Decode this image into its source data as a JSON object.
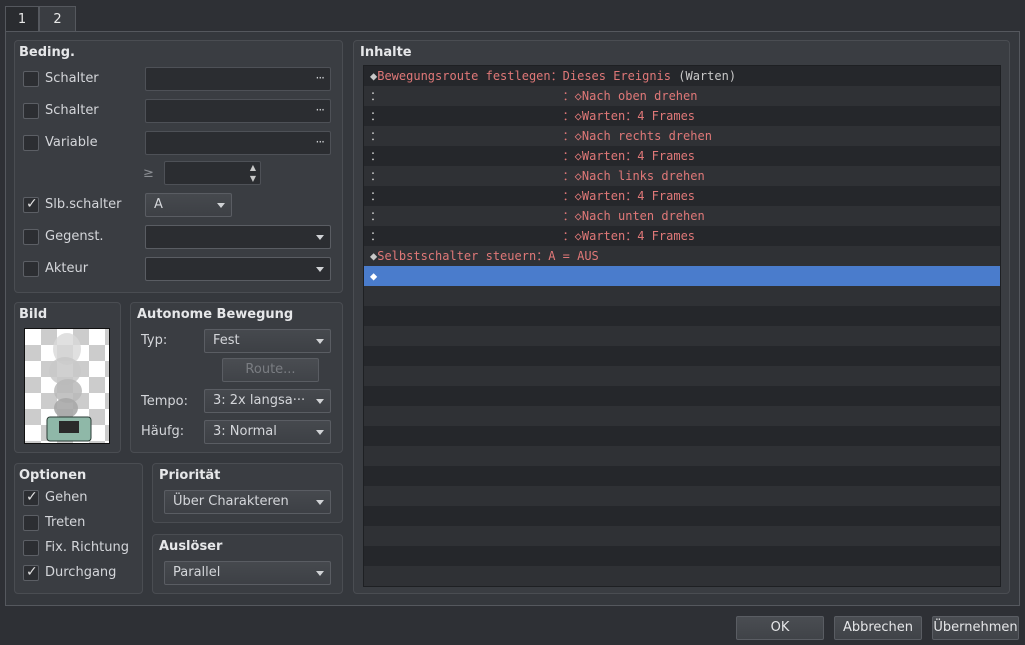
{
  "tabs": [
    {
      "label": "1"
    },
    {
      "label": "2"
    }
  ],
  "conditions": {
    "title": "Beding.",
    "switch1": {
      "label": "Schalter",
      "value": "",
      "button": "···"
    },
    "switch2": {
      "label": "Schalter",
      "value": "",
      "button": "···"
    },
    "variable": {
      "label": "Variable",
      "value": "",
      "button": "···"
    },
    "compare": {
      "symbol": "≥",
      "value": ""
    },
    "self_switch": {
      "label": "Slb.schalter",
      "checked": true,
      "value": "A"
    },
    "item": {
      "label": "Gegenst.",
      "value": ""
    },
    "actor": {
      "label": "Akteur",
      "value": ""
    }
  },
  "image": {
    "title": "Bild"
  },
  "autonomous": {
    "title": "Autonome Bewegung",
    "type_label": "Typ:",
    "type_value": "Fest",
    "route_button": "Route...",
    "speed_label": "Tempo:",
    "speed_value": "3: 2x langsa···",
    "freq_label": "Häufg:",
    "freq_value": "3: Normal"
  },
  "options": {
    "title": "Optionen",
    "items": [
      {
        "label": "Gehen",
        "checked": true
      },
      {
        "label": "Treten",
        "checked": false
      },
      {
        "label": "Fix. Richtung",
        "checked": false
      },
      {
        "label": "Durchgang",
        "checked": true
      }
    ]
  },
  "priority": {
    "title": "Priorität",
    "value": "Über Charakteren"
  },
  "trigger": {
    "title": "Auslöser",
    "value": "Parallel"
  },
  "contents": {
    "title": "Inhalte",
    "rows": [
      {
        "marker": "◆",
        "text": "Bewegungsroute festlegen",
        "sep": "：",
        "rest": "Dieses Ereignis",
        "suffix": " (Warten)"
      },
      {
        "marker": "：",
        "pad": "                         ",
        "sep": "：",
        "rest": "◇Nach oben drehen"
      },
      {
        "marker": "：",
        "pad": "                         ",
        "sep": "：",
        "rest": "◇Warten：4 Frames"
      },
      {
        "marker": "：",
        "pad": "                         ",
        "sep": "：",
        "rest": "◇Nach rechts drehen"
      },
      {
        "marker": "：",
        "pad": "                         ",
        "sep": "：",
        "rest": "◇Warten：4 Frames"
      },
      {
        "marker": "：",
        "pad": "                         ",
        "sep": "：",
        "rest": "◇Nach links drehen"
      },
      {
        "marker": "：",
        "pad": "                         ",
        "sep": "：",
        "rest": "◇Warten：4 Frames"
      },
      {
        "marker": "：",
        "pad": "                         ",
        "sep": "：",
        "rest": "◇Nach unten drehen"
      },
      {
        "marker": "：",
        "pad": "                         ",
        "sep": "：",
        "rest": "◇Warten：4 Frames"
      },
      {
        "marker": "◆",
        "text": "Selbstschalter steuern",
        "sep": "：",
        "rest": "A = AUS"
      },
      {
        "marker": "◆",
        "text": "",
        "selected": true
      }
    ]
  },
  "buttons": {
    "ok": "OK",
    "cancel": "Abbrechen",
    "apply": "Übernehmen"
  },
  "colors": {
    "selection": "#4a7ccc",
    "command_text": "#e07878"
  }
}
